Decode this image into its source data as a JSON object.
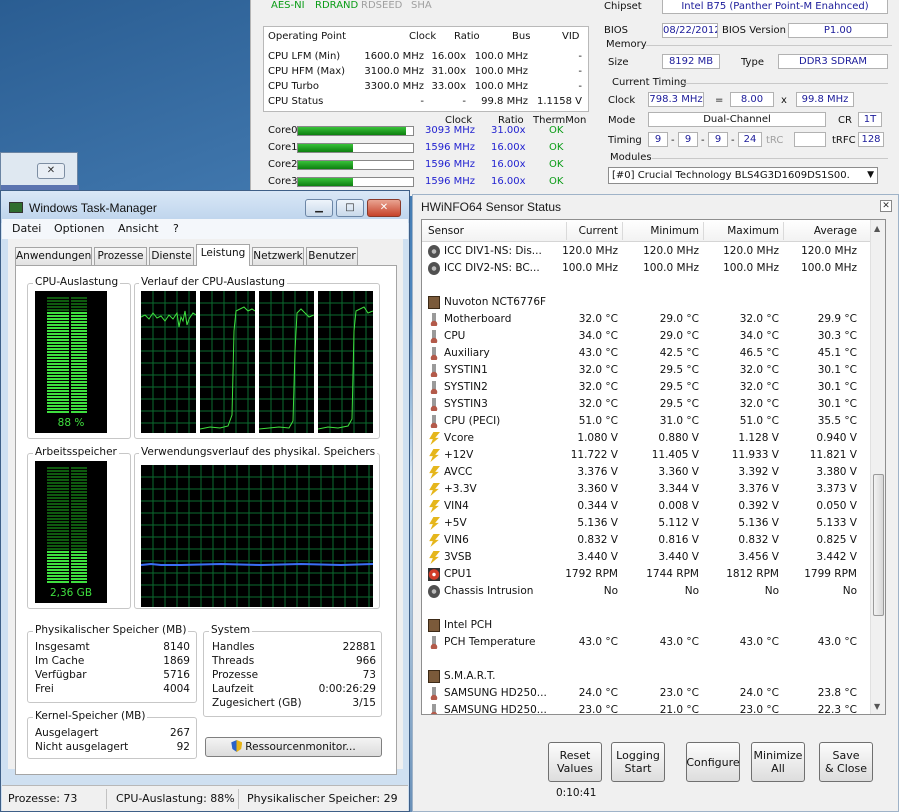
{
  "cpu_info": {
    "flags": [
      {
        "label": "AES-NI",
        "active": true
      },
      {
        "label": "RDRAND",
        "active": true
      },
      {
        "label": "RDSEED",
        "active": false
      },
      {
        "label": "SHA",
        "active": false
      }
    ],
    "op_headers": [
      "Operating Point",
      "Clock",
      "Ratio",
      "Bus",
      "VID"
    ],
    "op_rows": [
      {
        "name": "CPU LFM (Min)",
        "clock": "1600.0 MHz",
        "ratio": "16.00x",
        "bus": "100.0 MHz",
        "vid": "-"
      },
      {
        "name": "CPU HFM (Max)",
        "clock": "3100.0 MHz",
        "ratio": "31.00x",
        "bus": "100.0 MHz",
        "vid": "-"
      },
      {
        "name": "CPU Turbo",
        "clock": "3300.0 MHz",
        "ratio": "33.00x",
        "bus": "100.0 MHz",
        "vid": "-"
      },
      {
        "name": "CPU Status",
        "clock": "-",
        "ratio": "-",
        "bus": "99.8 MHz",
        "vid": "1.1158 V"
      }
    ],
    "core_headers": [
      "Clock",
      "Ratio",
      "ThermMon"
    ],
    "cores": [
      {
        "name": "Core0",
        "load": 0.94,
        "clock": "3093 MHz",
        "ratio": "31.00x",
        "therm": "OK"
      },
      {
        "name": "Core1",
        "load": 0.48,
        "clock": "1596 MHz",
        "ratio": "16.00x",
        "therm": "OK"
      },
      {
        "name": "Core2",
        "load": 0.48,
        "clock": "1596 MHz",
        "ratio": "16.00x",
        "therm": "OK"
      },
      {
        "name": "Core3",
        "load": 0.48,
        "clock": "1596 MHz",
        "ratio": "16.00x",
        "therm": "OK"
      }
    ],
    "mb": {
      "chipset_label": "Chipset",
      "chipset_value": "Intel B75 (Panther Point-M Enahnced)",
      "bios_label": "BIOS",
      "bios_date": "08/22/2012",
      "bios_version_label": "BIOS Version",
      "bios_version": "P1.00",
      "memory_label": "Memory",
      "size_label": "Size",
      "size_value": "8192 MB",
      "type_label": "Type",
      "type_value": "DDR3 SDRAM",
      "timing_group": "Current Timing",
      "clock_label": "Clock",
      "clock_value": "798.3 MHz",
      "eq": "=",
      "mult": "8.00",
      "x": "x",
      "base": "99.8 MHz",
      "mode_label": "Mode",
      "mode_value": "Dual-Channel",
      "cr_label": "CR",
      "cr_value": "1T",
      "timing_label": "Timing",
      "timings": [
        "9",
        "9",
        "9",
        "24"
      ],
      "trc_label": "tRC",
      "trfc_label": "tRFC",
      "trfc_value": "128",
      "modules_label": "Modules",
      "module_selected": "[#0] Crucial Technology BLS4G3D1609DS1S00."
    }
  },
  "back_dialog": {
    "close": "✕"
  },
  "task_manager": {
    "title": "Windows Task-Manager",
    "window_buttons": {
      "minimize": "▁",
      "maximize": "□",
      "close": "✕"
    },
    "menu": [
      "Datei",
      "Optionen",
      "Ansicht",
      "?"
    ],
    "tabs": [
      "Anwendungen",
      "Prozesse",
      "Dienste",
      "Leistung",
      "Netzwerk",
      "Benutzer"
    ],
    "active_tab": "Leistung",
    "cpu_usage_title": "CPU-Auslastung",
    "cpu_usage_value": "88 %",
    "cpu_usage_fraction": 0.88,
    "cpu_history_title": "Verlauf der CPU-Auslastung",
    "memory_title": "Arbeitsspeicher",
    "memory_value": "2,36 GB",
    "memory_fraction": 0.29,
    "memory_history_title": "Verwendungsverlauf des physikal. Speichers",
    "physical_title": "Physikalischer Speicher (MB)",
    "physical": [
      {
        "k": "Insgesamt",
        "v": "8140"
      },
      {
        "k": "Im Cache",
        "v": "1869"
      },
      {
        "k": "Verfügbar",
        "v": "5716"
      },
      {
        "k": "Frei",
        "v": "4004"
      }
    ],
    "kernel_title": "Kernel-Speicher (MB)",
    "kernel": [
      {
        "k": "Ausgelagert",
        "v": "267"
      },
      {
        "k": "Nicht ausgelagert",
        "v": "92"
      }
    ],
    "system_title": "System",
    "system": [
      {
        "k": "Handles",
        "v": "22881"
      },
      {
        "k": "Threads",
        "v": "966"
      },
      {
        "k": "Prozesse",
        "v": "73"
      },
      {
        "k": "Laufzeit",
        "v": "0:00:26:29"
      },
      {
        "k": "Zugesichert (GB)",
        "v": "3/15"
      }
    ],
    "resource_button": "Ressourcenmonitor...",
    "status": {
      "processes": "Prozesse: 73",
      "cpu": "CPU-Auslastung: 88%",
      "memory": "Physikalischer Speicher: 29"
    }
  },
  "hwinfo": {
    "title": "HWiNFO64 Sensor Status",
    "close": "✕",
    "columns": [
      "Sensor",
      "Current",
      "Minimum",
      "Maximum",
      "Average"
    ],
    "rows": [
      {
        "icon": "gauge",
        "name": "ICC DIV1-NS: Dis...",
        "cur": "120.0 MHz",
        "min": "120.0 MHz",
        "max": "120.0 MHz",
        "avg": "120.0 MHz"
      },
      {
        "icon": "gauge",
        "name": "ICC DIV2-NS: BC...",
        "cur": "100.0 MHz",
        "min": "100.0 MHz",
        "max": "100.0 MHz",
        "avg": "100.0 MHz"
      },
      {
        "icon": "none",
        "name": "",
        "cur": "",
        "min": "",
        "max": "",
        "avg": ""
      },
      {
        "icon": "chip",
        "name": "Nuvoton NCT6776F",
        "cur": "",
        "min": "",
        "max": "",
        "avg": ""
      },
      {
        "icon": "thermo",
        "name": "Motherboard",
        "cur": "32.0 °C",
        "min": "29.0 °C",
        "max": "32.0 °C",
        "avg": "29.9 °C"
      },
      {
        "icon": "thermo",
        "name": "CPU",
        "cur": "34.0 °C",
        "min": "29.0 °C",
        "max": "34.0 °C",
        "avg": "30.3 °C"
      },
      {
        "icon": "thermo",
        "name": "Auxiliary",
        "cur": "43.0 °C",
        "min": "42.5 °C",
        "max": "46.5 °C",
        "avg": "45.1 °C"
      },
      {
        "icon": "thermo",
        "name": "SYSTIN1",
        "cur": "32.0 °C",
        "min": "29.5 °C",
        "max": "32.0 °C",
        "avg": "30.1 °C"
      },
      {
        "icon": "thermo",
        "name": "SYSTIN2",
        "cur": "32.0 °C",
        "min": "29.5 °C",
        "max": "32.0 °C",
        "avg": "30.1 °C"
      },
      {
        "icon": "thermo",
        "name": "SYSTIN3",
        "cur": "32.0 °C",
        "min": "29.5 °C",
        "max": "32.0 °C",
        "avg": "30.1 °C"
      },
      {
        "icon": "thermo",
        "name": "CPU (PECI)",
        "cur": "51.0 °C",
        "min": "31.0 °C",
        "max": "51.0 °C",
        "avg": "35.5 °C"
      },
      {
        "icon": "bolt",
        "name": "Vcore",
        "cur": "1.080 V",
        "min": "0.880 V",
        "max": "1.128 V",
        "avg": "0.940 V"
      },
      {
        "icon": "bolt",
        "name": "+12V",
        "cur": "11.722 V",
        "min": "11.405 V",
        "max": "11.933 V",
        "avg": "11.821 V"
      },
      {
        "icon": "bolt",
        "name": "AVCC",
        "cur": "3.376 V",
        "min": "3.360 V",
        "max": "3.392 V",
        "avg": "3.380 V"
      },
      {
        "icon": "bolt",
        "name": "+3.3V",
        "cur": "3.360 V",
        "min": "3.344 V",
        "max": "3.376 V",
        "avg": "3.373 V"
      },
      {
        "icon": "bolt",
        "name": "VIN4",
        "cur": "0.344 V",
        "min": "0.008 V",
        "max": "0.392 V",
        "avg": "0.050 V"
      },
      {
        "icon": "bolt",
        "name": "+5V",
        "cur": "5.136 V",
        "min": "5.112 V",
        "max": "5.136 V",
        "avg": "5.133 V"
      },
      {
        "icon": "bolt",
        "name": "VIN6",
        "cur": "0.832 V",
        "min": "0.816 V",
        "max": "0.832 V",
        "avg": "0.825 V"
      },
      {
        "icon": "bolt",
        "name": "3VSB",
        "cur": "3.440 V",
        "min": "3.440 V",
        "max": "3.456 V",
        "avg": "3.442 V"
      },
      {
        "icon": "fan",
        "name": "CPU1",
        "cur": "1792 RPM",
        "min": "1744 RPM",
        "max": "1812 RPM",
        "avg": "1799 RPM"
      },
      {
        "icon": "gauge",
        "name": "Chassis Intrusion",
        "cur": "No",
        "min": "No",
        "max": "No",
        "avg": "No"
      },
      {
        "icon": "none",
        "name": "",
        "cur": "",
        "min": "",
        "max": "",
        "avg": ""
      },
      {
        "icon": "chip",
        "name": "Intel PCH",
        "cur": "",
        "min": "",
        "max": "",
        "avg": ""
      },
      {
        "icon": "thermo",
        "name": "PCH Temperature",
        "cur": "43.0 °C",
        "min": "43.0 °C",
        "max": "43.0 °C",
        "avg": "43.0 °C"
      },
      {
        "icon": "none",
        "name": "",
        "cur": "",
        "min": "",
        "max": "",
        "avg": ""
      },
      {
        "icon": "chip",
        "name": "S.M.A.R.T.",
        "cur": "",
        "min": "",
        "max": "",
        "avg": ""
      },
      {
        "icon": "thermo",
        "name": "SAMSUNG HD250...",
        "cur": "24.0 °C",
        "min": "23.0 °C",
        "max": "24.0 °C",
        "avg": "23.8 °C"
      },
      {
        "icon": "thermo",
        "name": "SAMSUNG HD250...",
        "cur": "23.0 °C",
        "min": "21.0 °C",
        "max": "23.0 °C",
        "avg": "22.3 °C"
      }
    ],
    "buttons": [
      {
        "line1": "Reset",
        "line2": "Values"
      },
      {
        "line1": "Logging",
        "line2": "Start"
      },
      {
        "line1": "Configure",
        "line2": ""
      },
      {
        "line1": "Minimize",
        "line2": "All"
      },
      {
        "line1": "Save",
        "line2": "& Close"
      }
    ],
    "timer": "0:10:41"
  },
  "colors": {
    "accent_green": "#3fe03f",
    "ok_green": "#0a9c16",
    "value_blue": "#1f1fd0"
  }
}
